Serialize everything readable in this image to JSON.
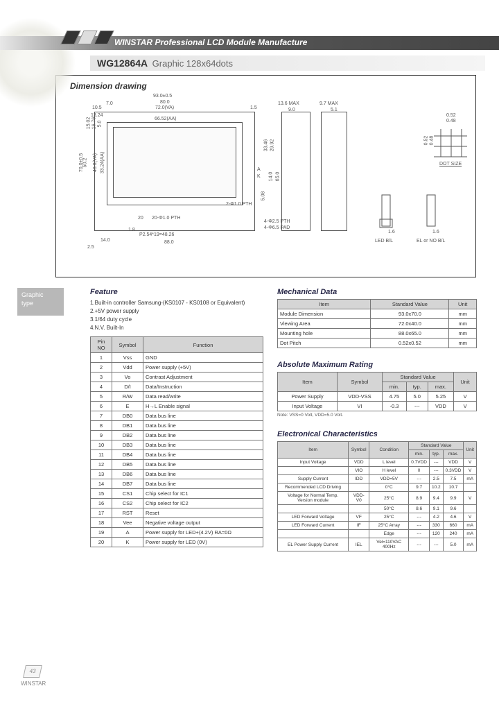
{
  "header": {
    "brand": "WINSTAR",
    "tagline": "Professional LCD Module Manufacture"
  },
  "title": {
    "model": "WG12864A",
    "desc": "Graphic 128x64dots"
  },
  "drawing": {
    "heading": "Dimension drawing",
    "top_dims": [
      "93.0±0.5",
      "80.0",
      "72.0(VA)",
      "66.52(AA)",
      "1.5"
    ],
    "top_left": [
      "10.5",
      "13.24",
      "7.0"
    ],
    "side": [
      "13.6 MAX",
      "9.0",
      "9.7 MAX",
      "5.1"
    ],
    "right_h": [
      "33.46",
      "29.92"
    ],
    "right_pin": [
      "A",
      "K"
    ],
    "right_v": [
      "14.0",
      "65.0"
    ],
    "pth": [
      "2-Φ1.0 PTH",
      "4-Φ2.5 PTH",
      "4-Φ6.5 PAD"
    ],
    "left_v": [
      "70.0±0.5",
      "50.2",
      "40.0(VA)",
      "33.24(AA)",
      "15.02",
      "16.76",
      "5.0"
    ],
    "bottom": [
      "14.0",
      "2.5",
      "20",
      "20-Φ1.0 PTH",
      "1.8",
      "P2.54*19=48.26",
      "88.0",
      "5.08"
    ],
    "dotsize": [
      "0.52",
      "0.48",
      "0.52",
      "0.48",
      "DOT SIZE"
    ],
    "bl": [
      "1.6",
      "1.6",
      "LED B/L",
      "EL or NO B/L"
    ]
  },
  "sidebar": {
    "line1": "Graphic",
    "line2": "type"
  },
  "feature": {
    "heading": "Feature",
    "items": [
      "1.Built-in controller Samsung-(KS0107 - KS0108 or Equivalent)",
      "2.+5V power supply",
      "3.1/64 duty cycle",
      "4.N.V. Built-In"
    ]
  },
  "pintable": {
    "headers": [
      "Pin NO",
      "Symbol",
      "Function"
    ],
    "rows": [
      [
        "1",
        "Vss",
        "GND"
      ],
      [
        "2",
        "Vdd",
        "Power supply (+5V)"
      ],
      [
        "3",
        "Vo",
        "Contrast Adjustment"
      ],
      [
        "4",
        "D/I",
        "Data/Instruction"
      ],
      [
        "5",
        "R/W",
        "Data read/write"
      ],
      [
        "6",
        "E",
        "H→L Enable signal"
      ],
      [
        "7",
        "DB0",
        "Data bus line"
      ],
      [
        "8",
        "DB1",
        "Data bus line"
      ],
      [
        "9",
        "DB2",
        "Data bus line"
      ],
      [
        "10",
        "DB3",
        "Data bus line"
      ],
      [
        "11",
        "DB4",
        "Data bus line"
      ],
      [
        "12",
        "DB5",
        "Data bus line"
      ],
      [
        "13",
        "DB6",
        "Data bus line"
      ],
      [
        "14",
        "DB7",
        "Data bus line"
      ],
      [
        "15",
        "CS1",
        "Chip select for IC1"
      ],
      [
        "16",
        "CS2",
        "Chip select for IC2"
      ],
      [
        "17",
        "RST",
        "Reset"
      ],
      [
        "18",
        "Vee",
        "Negative voltage output"
      ],
      [
        "19",
        "A",
        "Power supply for LED+(4.2V) RA=0Ω"
      ],
      [
        "20",
        "K",
        "Power supply for LED (0V)"
      ]
    ]
  },
  "mech": {
    "heading": "Mechanical Data",
    "headers": [
      "Item",
      "Standard Value",
      "Unit"
    ],
    "rows": [
      [
        "Module Dimension",
        "93.0x70.0",
        "mm"
      ],
      [
        "Viewing Area",
        "72.0x40.0",
        "mm"
      ],
      [
        "Mounting hole",
        "88.0x65.0",
        "mm"
      ],
      [
        "Dot Pitch",
        "0.52x0.52",
        "mm"
      ]
    ]
  },
  "abs": {
    "heading": "Absolute Maximum Rating",
    "headers": [
      "Item",
      "Symbol",
      "min.",
      "typ.",
      "max.",
      "Unit"
    ],
    "rows": [
      [
        "Power Supply",
        "VDD-VSS",
        "4.75",
        "5.0",
        "5.25",
        "V"
      ],
      [
        "Input Voltage",
        "VI",
        "-0.3",
        "---",
        "VDD",
        "V"
      ]
    ],
    "note": "Note: VSS=0 Volt, VDD=5.0 Volt."
  },
  "elec": {
    "heading": "Electronical Characteristics",
    "headers": [
      "Item",
      "Symbol",
      "Condition",
      "min.",
      "typ.",
      "max.",
      "Unit"
    ],
    "rows": [
      [
        "Input Voltage",
        "VDD",
        "L level",
        "0.7VDD",
        "---",
        "VDD",
        "V"
      ],
      [
        "",
        "VIO",
        "H level",
        "0",
        "---",
        "0.3VDD",
        "V"
      ],
      [
        "Supply Current",
        "IDD",
        "VDD=5V",
        "---",
        "2.5",
        "7.5",
        "mA"
      ],
      [
        "Recommended LCD Driving",
        "",
        "0°C",
        "9.7",
        "10.2",
        "10.7",
        ""
      ],
      [
        "Voltage for Normal Temp. Version module",
        "VDD-V0",
        "25°C",
        "8.9",
        "9.4",
        "9.9",
        "V"
      ],
      [
        "",
        "",
        "50°C",
        "8.6",
        "9.1",
        "9.6",
        ""
      ],
      [
        "LED Forward Voltage",
        "VF",
        "25°C",
        "---",
        "4.2",
        "4.6",
        "V"
      ],
      [
        "LED Forward Current",
        "IF",
        "25°C Array",
        "---",
        "330",
        "660",
        "mA"
      ],
      [
        "",
        "",
        "Edge",
        "---",
        "120",
        "240",
        "mA"
      ],
      [
        "EL Power Supply Current",
        "IEL",
        "Vel=110VAC 400Hz",
        "---",
        "---",
        "5.0",
        "mA"
      ]
    ]
  },
  "footer": {
    "page": "43",
    "brand": "WINSTAR"
  }
}
